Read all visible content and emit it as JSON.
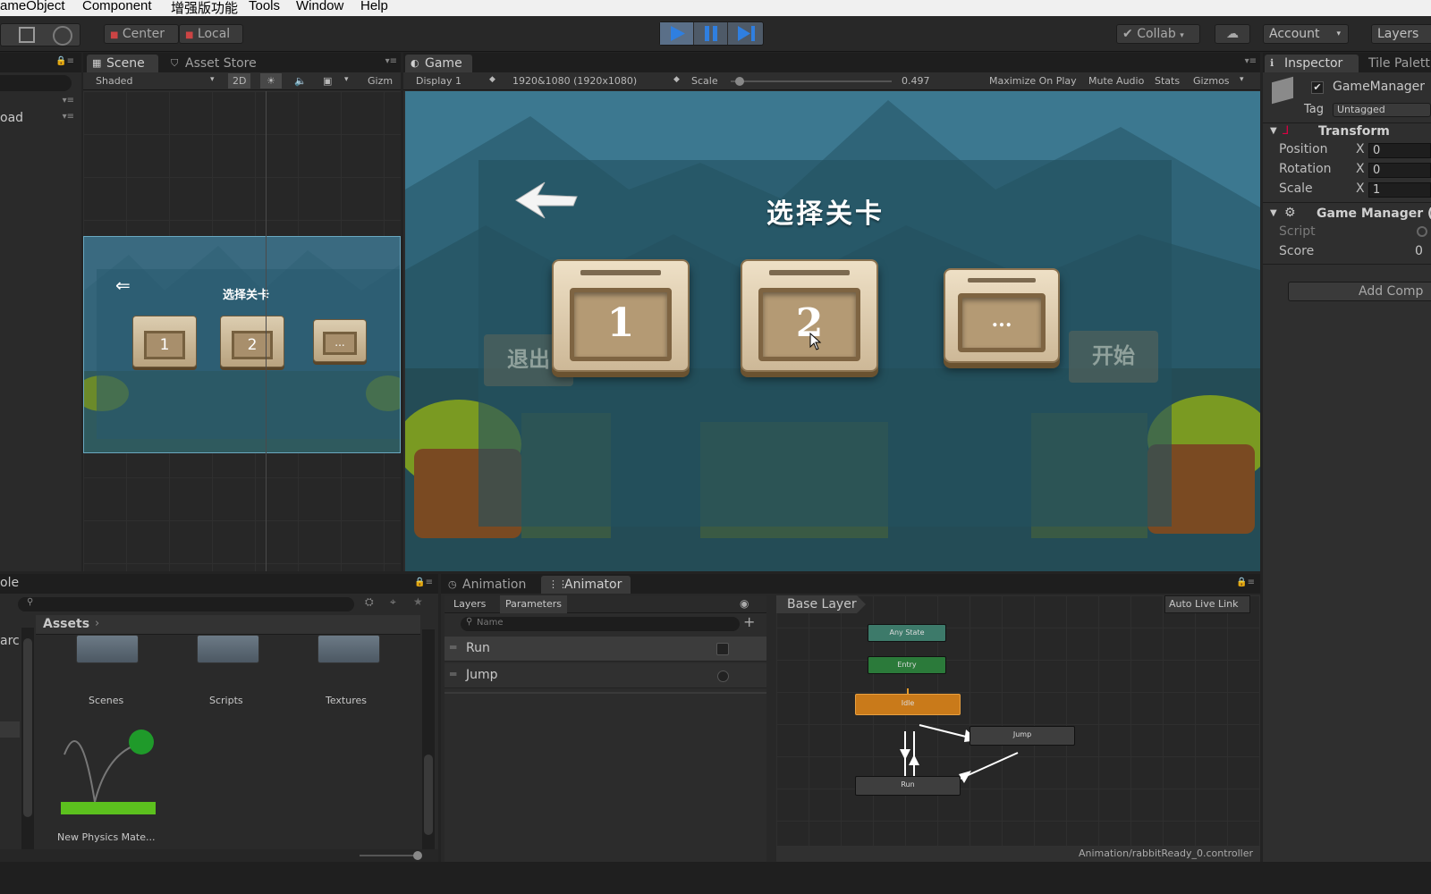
{
  "menubar": {
    "items": [
      "ameObject",
      "Component",
      "增强版功能",
      "Tools",
      "Window",
      "Help"
    ]
  },
  "toolbar": {
    "center_label": "Center",
    "local_label": "Local",
    "collab_label": "Collab",
    "account_label": "Account",
    "layers_label": "Layers"
  },
  "left_panel": {
    "load_label": "oad"
  },
  "scene": {
    "tabs": [
      "Scene",
      "Asset Store"
    ],
    "shading": "Shaded",
    "mode_2d": "2D",
    "gizmos": "Gizm",
    "mini": {
      "title": "选择关卡",
      "levels": [
        "1",
        "2",
        "..."
      ]
    }
  },
  "game": {
    "tab": "Game",
    "display": "Display 1",
    "resolution": "1920&1080 (1920x1080)",
    "scale_label": "Scale",
    "scale_value": "0.497",
    "scale_fraction": 0.03,
    "toggles": [
      "Maximize On Play",
      "Mute Audio",
      "Stats",
      "Gizmos"
    ],
    "overlay": {
      "title": "选择关卡",
      "levels": [
        "1",
        "2",
        "..."
      ],
      "sign_exit": "退出",
      "sign_start": "开始"
    }
  },
  "inspector": {
    "tabs": [
      "Inspector",
      "Tile Palett"
    ],
    "object_name": "GameManager",
    "tag_label": "Tag",
    "tag_value": "Untagged",
    "transform": {
      "header": "Transform",
      "rows": [
        {
          "label": "Position",
          "axis": "X",
          "value": "0"
        },
        {
          "label": "Rotation",
          "axis": "X",
          "value": "0"
        },
        {
          "label": "Scale",
          "axis": "X",
          "value": "1"
        }
      ]
    },
    "component": {
      "header": "Game Manager (",
      "script_label": "Script",
      "score_label": "Score",
      "score_value": "0"
    },
    "add_component": "Add Comp"
  },
  "project": {
    "tab": "ole",
    "side_label": "arc",
    "breadcrumb": "Assets",
    "folders": [
      "Scenes",
      "Scripts",
      "Textures"
    ],
    "material": "New Physics Mate..."
  },
  "animator": {
    "tabs": [
      "Animation",
      "Animator"
    ],
    "layers_tab": "Layers",
    "params_tab": "Parameters",
    "search_placeholder": "Name",
    "params": [
      {
        "name": "Run",
        "type": "bool"
      },
      {
        "name": "Jump",
        "type": "trigger"
      }
    ],
    "base_layer": "Base Layer",
    "auto_live_link": "Auto Live Link",
    "states": {
      "any": "Any State",
      "entry": "Entry",
      "idle": "Idle",
      "jump": "Jump",
      "run": "Run"
    },
    "controller_path": "Animation/rabbitReady_0.controller"
  },
  "colors": {
    "accent": "#3d6fa8",
    "idle_state": "#c97a1a",
    "entry_state": "#2b7a3a",
    "any_state": "#3d7a6a"
  }
}
